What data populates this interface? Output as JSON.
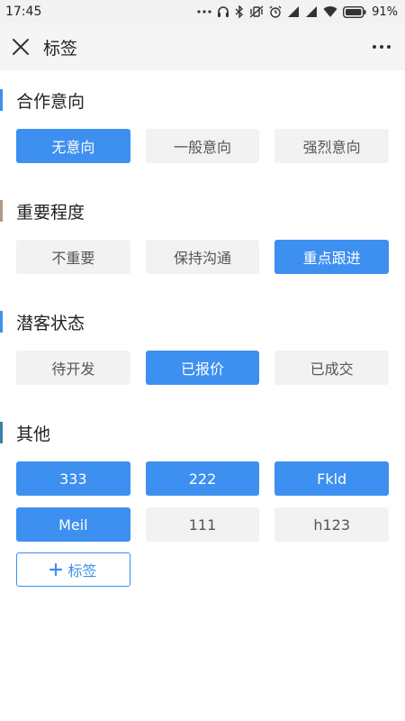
{
  "status": {
    "time": "17:45",
    "battery_percent": "91%",
    "icons": [
      "dots-icon",
      "headphone-icon",
      "bluetooth-icon",
      "vibrate-icon",
      "alarm-icon",
      "signal-icon",
      "signal-icon",
      "wifi-icon",
      "battery-icon"
    ]
  },
  "appbar": {
    "title": "标签",
    "close_icon": "close-icon",
    "more_icon": "more-icon"
  },
  "sections": [
    {
      "title": "合作意向",
      "accent": "#3d8ff0",
      "chips": [
        {
          "label": "无意向",
          "active": true
        },
        {
          "label": "一般意向",
          "active": false
        },
        {
          "label": "强烈意向",
          "active": false
        }
      ]
    },
    {
      "title": "重要程度",
      "accent": "#b09a86",
      "chips": [
        {
          "label": "不重要",
          "active": false
        },
        {
          "label": "保持沟通",
          "active": false
        },
        {
          "label": "重点跟进",
          "active": true
        }
      ]
    },
    {
      "title": "潜客状态",
      "accent": "#3d8ff0",
      "chips": [
        {
          "label": "待开发",
          "active": false
        },
        {
          "label": "已报价",
          "active": true
        },
        {
          "label": "已成交",
          "active": false
        }
      ]
    },
    {
      "title": "其他",
      "accent": "#3d7fa8",
      "chips": [
        {
          "label": "333",
          "active": true
        },
        {
          "label": "222",
          "active": true
        },
        {
          "label": "Fkld",
          "active": true
        },
        {
          "label": "Meil",
          "active": true
        },
        {
          "label": "111",
          "active": false
        },
        {
          "label": "h123",
          "active": false
        }
      ],
      "add_button_label": "标签"
    }
  ],
  "colors": {
    "accent_blue": "#3d8ff0",
    "chip_inactive_bg": "#f2f2f2"
  }
}
